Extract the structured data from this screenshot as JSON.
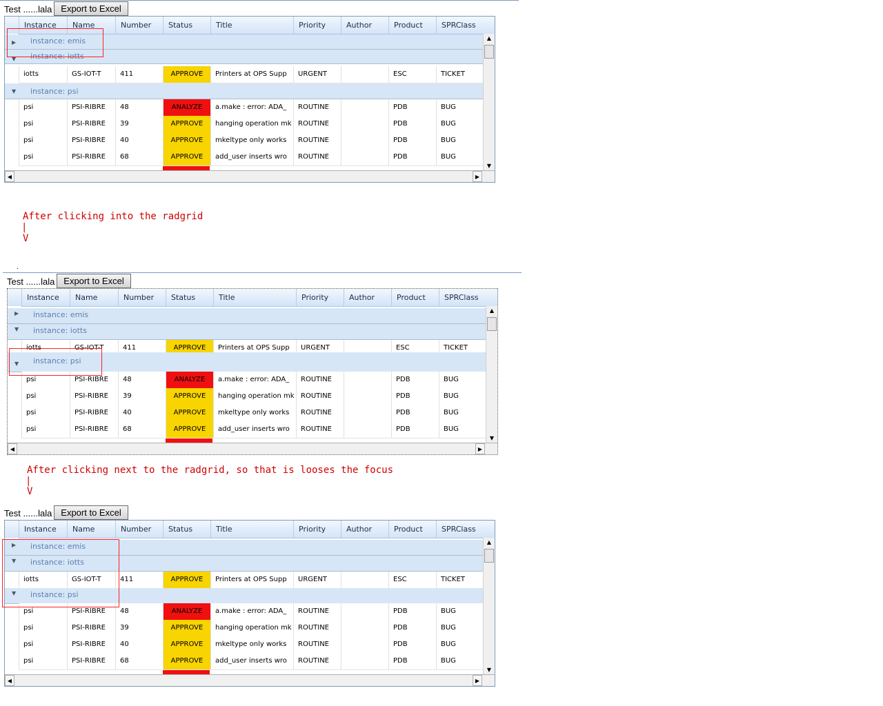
{
  "toolbar": {
    "text": "Test ......lala",
    "export_label": "Export to Excel"
  },
  "columns": [
    "Instance",
    "Name",
    "Number",
    "Status",
    "Title",
    "Priority",
    "Author",
    "Product",
    "SPRClass"
  ],
  "groups": {
    "emis": "instance: emis",
    "iotts": "instance: iotts",
    "psi": "instance: psi"
  },
  "rows": {
    "iotts": [
      "iotts",
      "GS-IOT-T",
      "411",
      "APPROVE",
      "Printers at OPS Supp",
      "URGENT",
      "",
      "ESC",
      "TICKET"
    ],
    "psi": [
      [
        "psi",
        "PSI-RIBRE",
        "48",
        "ANALYZE",
        "a.make : error: ADA_",
        "ROUTINE",
        "",
        "PDB",
        "BUG"
      ],
      [
        "psi",
        "PSI-RIBRE",
        "39",
        "APPROVE",
        "hanging operation mk",
        "ROUTINE",
        "",
        "PDB",
        "BUG"
      ],
      [
        "psi",
        "PSI-RIBRE",
        "40",
        "APPROVE",
        "mkeltype only works",
        "ROUTINE",
        "",
        "PDB",
        "BUG"
      ],
      [
        "psi",
        "PSI-RIBRE",
        "68",
        "APPROVE",
        "add_user inserts wro",
        "ROUTINE",
        "",
        "PDB",
        "BUG"
      ]
    ]
  },
  "annotations": {
    "a1_text": "After clicking into the radgrid",
    "a1_bar": "|",
    "a1_arrow": "V",
    "a2_text": "After clicking next to the radgrid, so that is looses the focus",
    "a2_bar": "|",
    "a2_arrow": "V"
  },
  "colors": {
    "approve": "#f8d400",
    "analyze": "#f01010",
    "annotation": "#d00000",
    "group_bg": "#d6e6f6"
  },
  "icons": {
    "expanded": "triangle-down-icon",
    "collapsed": "triangle-right-icon",
    "scroll_up": "arrow-up-icon",
    "scroll_down": "arrow-down-icon",
    "scroll_left": "arrow-left-icon",
    "scroll_right": "arrow-right-icon"
  }
}
